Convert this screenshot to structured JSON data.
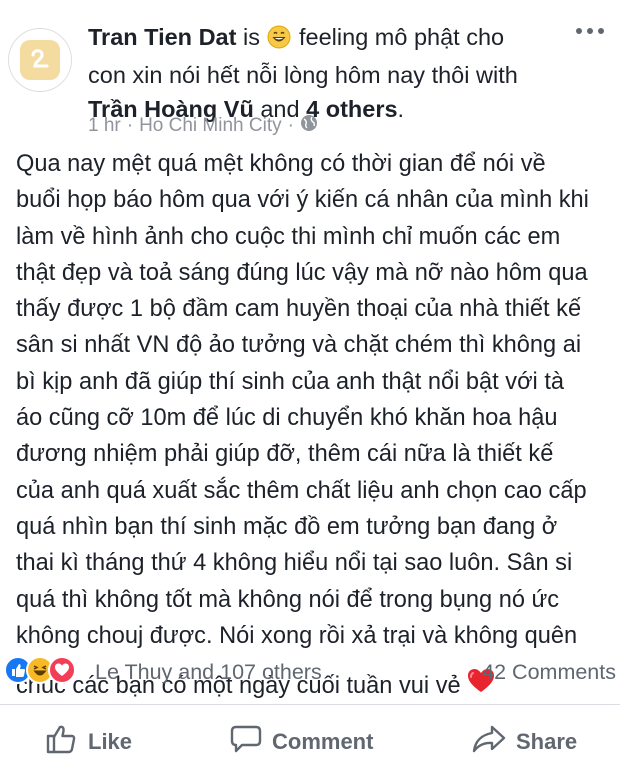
{
  "post": {
    "author": "Tran Tien Dat",
    "is_text": "is",
    "feeling_emoji": "grinning-face",
    "feeling_text": "feeling mô phật cho",
    "feeling_text2": "con xin nói hết nỗi lòng hôm nay thôi with",
    "tagged_person": "Trần Hoàng Vũ",
    "and_text": "and",
    "others_text": "4 others",
    "period": ".",
    "time": "1 hr",
    "separator": "·",
    "location": "Ho Chi Minh City",
    "privacy_icon": "globe-icon",
    "body_lines": [
      "Qua nay mệt quá mệt không có thời gian để nói về",
      "buổi họp báo hôm qua với ý kiến cá nhân của mình khi",
      "làm về hình ảnh cho cuộc thi mình chỉ muốn các em",
      "thật đẹp và toả sáng đúng lúc vậy mà nỡ nào hôm qua",
      "thấy được 1 bộ đầm cam huyền thoại của nhà thiết kế",
      "sân si nhất VN độ ảo tưởng và chặt chém thì không ai",
      "bì kịp anh đã giúp thí sinh của anh thật nổi bật với tà",
      "áo cũng cỡ 10m để lúc di chuyển khó khăn hoa hậu",
      "đương nhiệm phải giúp đỡ, thêm cái nữa là thiết kế",
      "của anh quá xuất sắc thêm chất liệu anh chọn cao cấp",
      "quá nhìn bạn thí sinh mặc đồ em tưởng bạn đang ở",
      "thai kì tháng thứ 4 không hiểu nổi tại sao luôn. Sân si",
      "quá thì không tốt mà không nói để trong bụng nó ức",
      "không chouj được. Nói xong rồi xả trại và không quên"
    ],
    "body_last_line": "chúc các bạn có một ngày cuối tuần vui vẻ",
    "body_last_emoji": "red-heart"
  },
  "reactions": {
    "icons": [
      "like",
      "haha",
      "love"
    ],
    "summary": "Le Thuy and 107 others",
    "comments": "42 Comments"
  },
  "actions": {
    "like": "Like",
    "comment": "Comment",
    "share": "Share"
  },
  "colors": {
    "text": "#1d2129",
    "meta": "#90949c",
    "action": "#606770",
    "like_blue": "#1877f2",
    "love_red": "#f33e58",
    "haha_yellow": "#f7b928"
  }
}
